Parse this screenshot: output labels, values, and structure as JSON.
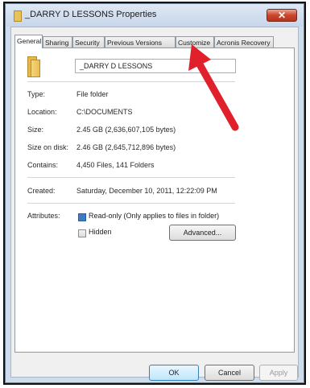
{
  "window": {
    "title": "_DARRY D LESSONS Properties",
    "close_glyph": "✕"
  },
  "tabs": [
    {
      "label": "General",
      "active": true
    },
    {
      "label": "Sharing",
      "active": false
    },
    {
      "label": "Security",
      "active": false
    },
    {
      "label": "Previous Versions",
      "active": false
    },
    {
      "label": "Customize",
      "active": false
    },
    {
      "label": "Acronis Recovery",
      "active": false
    }
  ],
  "general": {
    "name": "_DARRY D LESSONS",
    "rows": [
      {
        "label": "Type:",
        "value": "File folder"
      },
      {
        "label": "Location:",
        "value": "C:\\DOCUMENTS"
      },
      {
        "label": "Size:",
        "value": "2.45 GB (2,636,607,105 bytes)"
      },
      {
        "label": "Size on disk:",
        "value": "2.46 GB (2,645,712,896 bytes)"
      },
      {
        "label": "Contains:",
        "value": "4,450 Files, 141 Folders"
      }
    ],
    "created_label": "Created:",
    "created_value": "Saturday, December 10, 2011, 12:22:09 PM",
    "attributes_label": "Attributes:",
    "readonly": {
      "label": "Read-only (Only applies to files in folder)",
      "state": "indeterminate"
    },
    "hidden": {
      "label": "Hidden",
      "checked": false
    },
    "advanced_label": "Advanced..."
  },
  "buttons": {
    "ok": "OK",
    "cancel": "Cancel",
    "apply": "Apply"
  },
  "annotation": {
    "color": "#e0202a"
  },
  "colors": {
    "accent": "#3b7cc4",
    "close": "#c9452c"
  }
}
